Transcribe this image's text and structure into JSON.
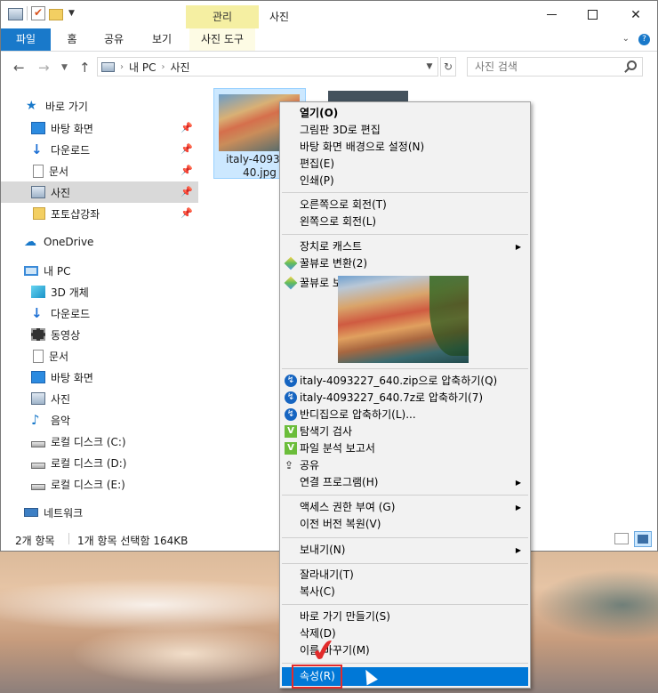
{
  "window": {
    "context_tab": "관리",
    "title": "사진",
    "ribbon_tabs": [
      "파일",
      "홈",
      "공유",
      "보기",
      "사진 도구"
    ]
  },
  "address": {
    "path": [
      "내 PC",
      "사진"
    ],
    "search_placeholder": "사진 검색"
  },
  "navpane": {
    "quick_access": "바로 가기",
    "quick_items": [
      "바탕 화면",
      "다운로드",
      "문서",
      "사진",
      "포토샵강좌"
    ],
    "onedrive": "OneDrive",
    "this_pc": "내 PC",
    "pc_items": [
      "3D 개체",
      "다운로드",
      "동영상",
      "문서",
      "바탕 화면",
      "사진",
      "음악",
      "로컬 디스크 (C:)",
      "로컬 디스크 (D:)",
      "로컬 디스크 (E:)"
    ],
    "network": "네트워크"
  },
  "file": {
    "name_line1": "italy-409322",
    "name_line2": "40.jpg"
  },
  "status": {
    "count": "2개 항목",
    "selected": "1개 항목 선택함 164KB"
  },
  "menu": {
    "open": "열기(O)",
    "edit3d": "그림판 3D로 편집",
    "set_bg": "바탕 화면 배경으로 설정(N)",
    "edit": "편집(E)",
    "print": "인쇄(P)",
    "rotate_right": "오른쪽으로 회전(T)",
    "rotate_left": "왼쪽으로 회전(L)",
    "cast": "장치로 캐스트",
    "honey_convert": "꿀뷰로 변환(2)",
    "honey_view": "꿀뷰로 보기(3)",
    "zip": "italy-4093227_640.zip으로 압축하기(Q)",
    "sevenz": "italy-4093227_640.7z로 압축하기(7)",
    "bandizip": "반디집으로 압축하기(L)...",
    "v3_scan": "탐색기 검사",
    "file_report": "파일 분석 보고서",
    "share": "공유",
    "open_with": "연결 프로그램(H)",
    "give_access": "액세스 권한 부여 (G)",
    "restore": "이전 버전 복원(V)",
    "send_to": "보내기(N)",
    "cut": "잘라내기(T)",
    "copy": "복사(C)",
    "create_shortcut": "바로 가기 만들기(S)",
    "delete": "삭제(D)",
    "rename": "이름 바꾸기(M)",
    "properties": "속성(R)"
  },
  "colors": {
    "accent": "#0078d7",
    "file_tab": "#1979ca",
    "highlight_red": "#e22b2b"
  }
}
